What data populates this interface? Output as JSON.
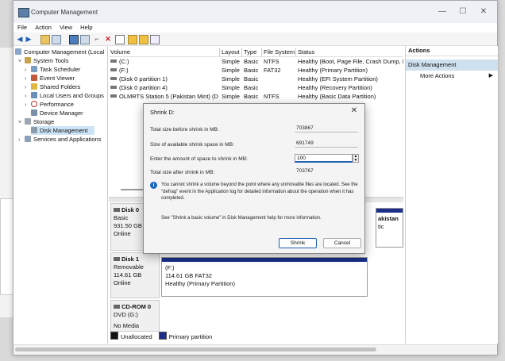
{
  "window": {
    "title": "Computer Management",
    "minimize_icon": "—",
    "maximize_icon": "☐",
    "close_icon": "✕"
  },
  "menu": [
    "File",
    "Action",
    "View",
    "Help"
  ],
  "tree": {
    "root": "Computer Management (Local",
    "system_tools": "System Tools",
    "items": [
      "Task Scheduler",
      "Event Viewer",
      "Shared Folders",
      "Local Users and Groups",
      "Performance",
      "Device Manager"
    ],
    "storage": "Storage",
    "disk_management": "Disk Management",
    "services": "Services and Applications"
  },
  "volumes": {
    "headers": [
      "Volume",
      "Layout",
      "Type",
      "File System",
      "Status"
    ],
    "rows": [
      [
        "(C:)",
        "Simple",
        "Basic",
        "NTFS",
        "Healthy (Boot, Page File, Crash Dump, I"
      ],
      [
        "(F:)",
        "Simple",
        "Basic",
        "FAT32",
        "Healthy (Primary Partition)"
      ],
      [
        "(Disk 0 partition 1)",
        "Simple",
        "Basic",
        "",
        "Healthy (EFI System Partition)"
      ],
      [
        "(Disk 0 partition 4)",
        "Simple",
        "Basic",
        "",
        "Healthy (Recovery Partition)"
      ],
      [
        "OLMRTS Station 5 (Pakistan Mint) (Ds)",
        "Simple",
        "Basic",
        "NTFS",
        "Healthy (Basic Data Partition)"
      ]
    ]
  },
  "disks": {
    "disk0": {
      "name": "Disk 0",
      "type": "Basic",
      "size": "931.50 GB",
      "state": "Online",
      "partial_label": "akistan",
      "partial_label2": "tic"
    },
    "disk1": {
      "name": "Disk 1",
      "type": "Removable",
      "size": "114.61 GB",
      "state": "Online",
      "part_name": "(F:)",
      "part_size": "114.61 GB FAT32",
      "part_status": "Healthy (Primary Partition)"
    },
    "cdrom": {
      "name": "CD-ROM 0",
      "type": "DVD (G:)",
      "state": "No Media"
    }
  },
  "legend": {
    "unallocated": "Unallocated",
    "primary": "Primary partition"
  },
  "actions": {
    "header": "Actions",
    "section": "Disk Management",
    "more": "More Actions",
    "more_arrow": "▶"
  },
  "dialog": {
    "title": "Shrink D:",
    "close_icon": "✕",
    "total_size_label": "Total size before shrink in MB:",
    "total_size": "703867",
    "available_label": "Size of available shrink space in MB:",
    "available": "691749",
    "amount_label": "Enter the amount of space to shrink in MB:",
    "amount": "100",
    "after_label": "Total size after shrink in MB:",
    "after": "703767",
    "info": "You cannot shrink a volume beyond the point where any unmovable files are located. See the \"defrag\" event in the Application log for detailed information about the operation when it has completed.",
    "help": "See \"Shrink a basic volume\" in Disk Management help for more information.",
    "shrink_button": "Shrink",
    "cancel_button": "Cancel"
  },
  "colors": {
    "primary_partition": "#1a2e8a",
    "selection": "#cde4f7",
    "accent": "#1f5fb0"
  }
}
